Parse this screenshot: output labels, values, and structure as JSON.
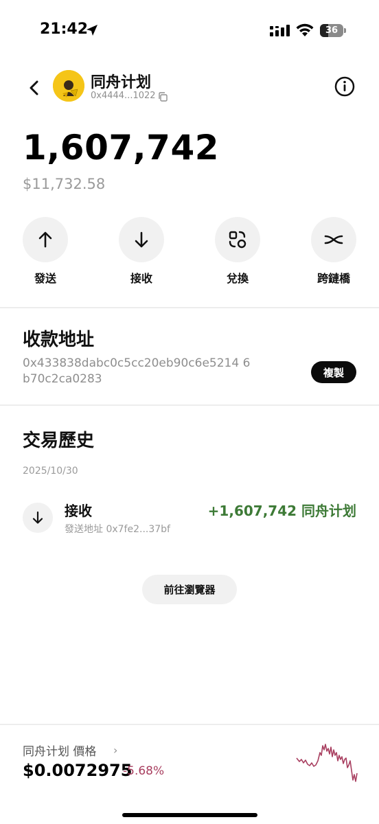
{
  "status_bar": {
    "time": "21:42",
    "battery_level": "36",
    "battery_fraction": 0.36
  },
  "token": {
    "name": "同舟计划",
    "address_short": "0x4444...1022",
    "avatar_text": "同舟计划",
    "balance": "1,607,742",
    "balance_usd": "$11,732.58"
  },
  "actions": [
    {
      "label": "發送",
      "icon": "arrow-up-icon"
    },
    {
      "label": "接收",
      "icon": "arrow-down-icon"
    },
    {
      "label": "兌換",
      "icon": "swap-icon"
    },
    {
      "label": "跨鏈橋",
      "icon": "bridge-icon"
    }
  ],
  "receive": {
    "title": "收款地址",
    "address": "0x433838dabc0c5cc20eb90c6e5214 6b70c2ca0283",
    "copy_label": "複製"
  },
  "history": {
    "title": "交易歷史",
    "date": "2025/10/30",
    "transactions": [
      {
        "type": "接收",
        "from": "發送地址 0x7fe2...37bf",
        "amount": "+1,607,742 同舟计划"
      }
    ],
    "explorer_label": "前往瀏覽器"
  },
  "price": {
    "title": "同舟计划 價格",
    "chevron": "›",
    "value": "$0.0072975",
    "change": "-5.68%",
    "change_color": "#a83e5f"
  },
  "colors": {
    "positive": "#3d7a36",
    "negative": "#a83e5f",
    "avatar_bg": "#f5c518"
  }
}
